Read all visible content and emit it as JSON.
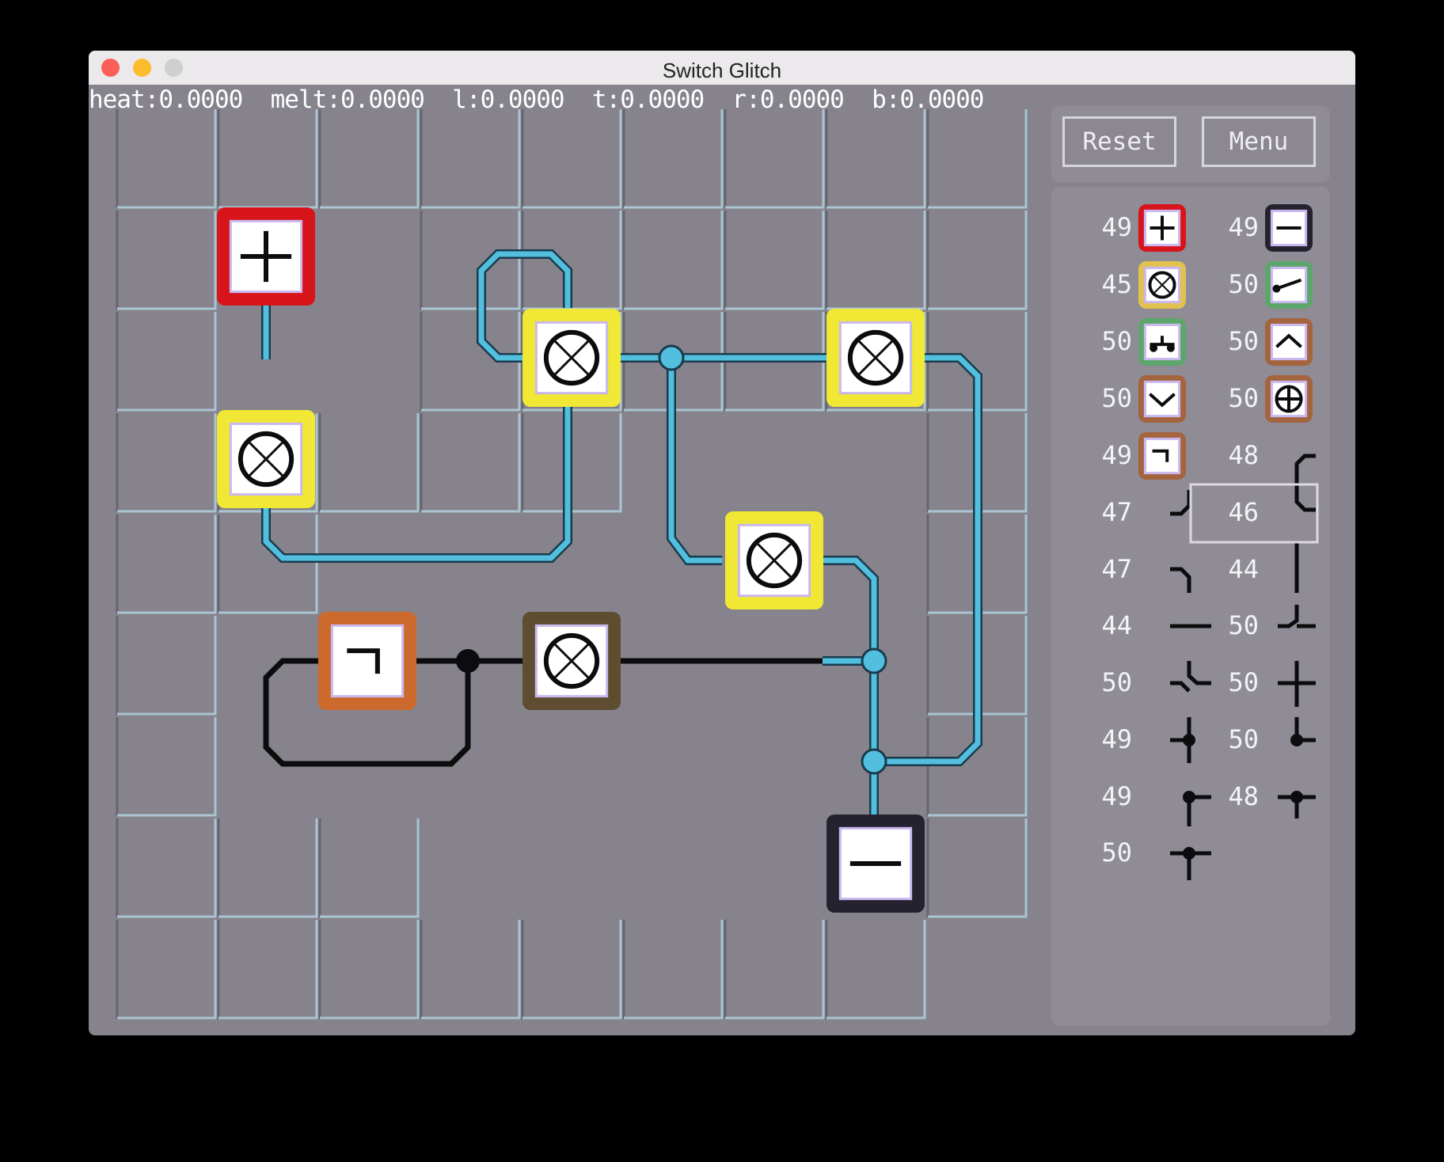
{
  "window": {
    "title": "Switch Glitch"
  },
  "status": {
    "text": "heat:0.0000  melt:0.0000  l:0.0000  t:0.0000  r:0.0000  b:0.0000"
  },
  "buttons": {
    "reset": "Reset",
    "menu": "Menu"
  },
  "palette": {
    "rows": [
      {
        "left": "49",
        "right": "49"
      },
      {
        "left": "45",
        "right": "50"
      },
      {
        "left": "50",
        "right": "50"
      },
      {
        "left": "50",
        "right": "50"
      },
      {
        "left": "49",
        "right": "48"
      },
      {
        "left": "47",
        "right": "46"
      },
      {
        "left": "47",
        "right": "44"
      },
      {
        "left": "44",
        "right": "50"
      },
      {
        "left": "50",
        "right": "50"
      },
      {
        "left": "49",
        "right": "50"
      },
      {
        "left": "49",
        "right": "48"
      },
      {
        "left": "50"
      }
    ],
    "items": [
      "plus-source",
      "minus-sink",
      "lamp",
      "switch",
      "button",
      "up-gate",
      "down-gate",
      "cross-gate",
      "not-gate",
      "wire-corner-bracket",
      "wire-corner-down",
      "wire-vertical-selected",
      "wire-corner-right",
      "wire-vertical",
      "wire-horizontal",
      "wire-bridge-right",
      "wire-step",
      "wire-cross",
      "wire-junction-left",
      "wire-junction-right",
      "wire-junction-down-left",
      "wire-junction-down-right",
      "wire-junction-tee"
    ]
  },
  "colors": {
    "wire_on": "#52bfdf",
    "wire_off": "#0c0c0e",
    "lamp_on": "#f1e735",
    "source": "#d8141b",
    "sink": "#24222e",
    "not_gate": "#cc6a2e",
    "lamp_off": "#5e4d31"
  }
}
